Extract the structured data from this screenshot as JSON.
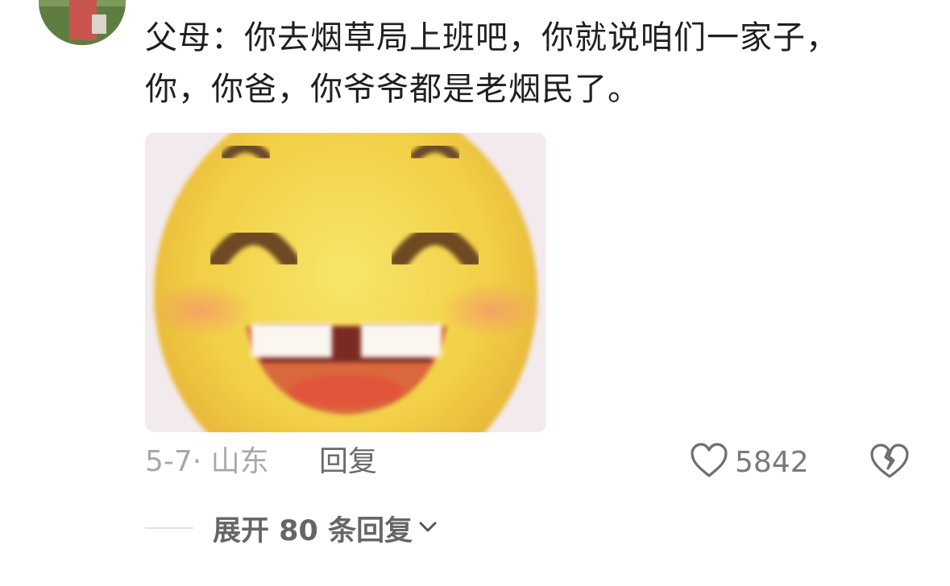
{
  "comment": {
    "lines": [
      "父母：你去烟草局上班吧，你就说咱们一家子，",
      "你，你爸，你爷爷都是老烟民了。"
    ],
    "date_location": "5-7· 山东",
    "reply_label": "回复",
    "like_count": "5842",
    "expand_label": "展开 80 条回复"
  },
  "icons": {
    "like": "heart-outline-icon",
    "dislike": "broken-heart-icon",
    "expand": "chevron-down-icon"
  },
  "colors": {
    "text_primary": "#1f1f1f",
    "text_meta": "#a8a8a8",
    "text_secondary": "#6a6a6a"
  }
}
